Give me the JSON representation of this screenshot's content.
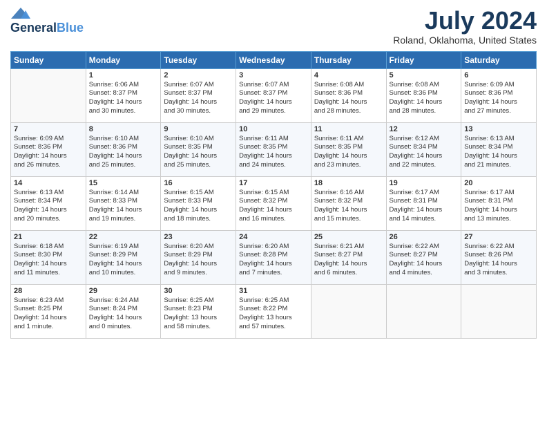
{
  "header": {
    "logo_line1": "General",
    "logo_line2": "Blue",
    "month_year": "July 2024",
    "location": "Roland, Oklahoma, United States"
  },
  "weekdays": [
    "Sunday",
    "Monday",
    "Tuesday",
    "Wednesday",
    "Thursday",
    "Friday",
    "Saturday"
  ],
  "weeks": [
    [
      {
        "day": "",
        "text": ""
      },
      {
        "day": "1",
        "text": "Sunrise: 6:06 AM\nSunset: 8:37 PM\nDaylight: 14 hours\nand 30 minutes."
      },
      {
        "day": "2",
        "text": "Sunrise: 6:07 AM\nSunset: 8:37 PM\nDaylight: 14 hours\nand 30 minutes."
      },
      {
        "day": "3",
        "text": "Sunrise: 6:07 AM\nSunset: 8:37 PM\nDaylight: 14 hours\nand 29 minutes."
      },
      {
        "day": "4",
        "text": "Sunrise: 6:08 AM\nSunset: 8:36 PM\nDaylight: 14 hours\nand 28 minutes."
      },
      {
        "day": "5",
        "text": "Sunrise: 6:08 AM\nSunset: 8:36 PM\nDaylight: 14 hours\nand 28 minutes."
      },
      {
        "day": "6",
        "text": "Sunrise: 6:09 AM\nSunset: 8:36 PM\nDaylight: 14 hours\nand 27 minutes."
      }
    ],
    [
      {
        "day": "7",
        "text": "Sunrise: 6:09 AM\nSunset: 8:36 PM\nDaylight: 14 hours\nand 26 minutes."
      },
      {
        "day": "8",
        "text": "Sunrise: 6:10 AM\nSunset: 8:36 PM\nDaylight: 14 hours\nand 25 minutes."
      },
      {
        "day": "9",
        "text": "Sunrise: 6:10 AM\nSunset: 8:35 PM\nDaylight: 14 hours\nand 25 minutes."
      },
      {
        "day": "10",
        "text": "Sunrise: 6:11 AM\nSunset: 8:35 PM\nDaylight: 14 hours\nand 24 minutes."
      },
      {
        "day": "11",
        "text": "Sunrise: 6:11 AM\nSunset: 8:35 PM\nDaylight: 14 hours\nand 23 minutes."
      },
      {
        "day": "12",
        "text": "Sunrise: 6:12 AM\nSunset: 8:34 PM\nDaylight: 14 hours\nand 22 minutes."
      },
      {
        "day": "13",
        "text": "Sunrise: 6:13 AM\nSunset: 8:34 PM\nDaylight: 14 hours\nand 21 minutes."
      }
    ],
    [
      {
        "day": "14",
        "text": "Sunrise: 6:13 AM\nSunset: 8:34 PM\nDaylight: 14 hours\nand 20 minutes."
      },
      {
        "day": "15",
        "text": "Sunrise: 6:14 AM\nSunset: 8:33 PM\nDaylight: 14 hours\nand 19 minutes."
      },
      {
        "day": "16",
        "text": "Sunrise: 6:15 AM\nSunset: 8:33 PM\nDaylight: 14 hours\nand 18 minutes."
      },
      {
        "day": "17",
        "text": "Sunrise: 6:15 AM\nSunset: 8:32 PM\nDaylight: 14 hours\nand 16 minutes."
      },
      {
        "day": "18",
        "text": "Sunrise: 6:16 AM\nSunset: 8:32 PM\nDaylight: 14 hours\nand 15 minutes."
      },
      {
        "day": "19",
        "text": "Sunrise: 6:17 AM\nSunset: 8:31 PM\nDaylight: 14 hours\nand 14 minutes."
      },
      {
        "day": "20",
        "text": "Sunrise: 6:17 AM\nSunset: 8:31 PM\nDaylight: 14 hours\nand 13 minutes."
      }
    ],
    [
      {
        "day": "21",
        "text": "Sunrise: 6:18 AM\nSunset: 8:30 PM\nDaylight: 14 hours\nand 11 minutes."
      },
      {
        "day": "22",
        "text": "Sunrise: 6:19 AM\nSunset: 8:29 PM\nDaylight: 14 hours\nand 10 minutes."
      },
      {
        "day": "23",
        "text": "Sunrise: 6:20 AM\nSunset: 8:29 PM\nDaylight: 14 hours\nand 9 minutes."
      },
      {
        "day": "24",
        "text": "Sunrise: 6:20 AM\nSunset: 8:28 PM\nDaylight: 14 hours\nand 7 minutes."
      },
      {
        "day": "25",
        "text": "Sunrise: 6:21 AM\nSunset: 8:27 PM\nDaylight: 14 hours\nand 6 minutes."
      },
      {
        "day": "26",
        "text": "Sunrise: 6:22 AM\nSunset: 8:27 PM\nDaylight: 14 hours\nand 4 minutes."
      },
      {
        "day": "27",
        "text": "Sunrise: 6:22 AM\nSunset: 8:26 PM\nDaylight: 14 hours\nand 3 minutes."
      }
    ],
    [
      {
        "day": "28",
        "text": "Sunrise: 6:23 AM\nSunset: 8:25 PM\nDaylight: 14 hours\nand 1 minute."
      },
      {
        "day": "29",
        "text": "Sunrise: 6:24 AM\nSunset: 8:24 PM\nDaylight: 14 hours\nand 0 minutes."
      },
      {
        "day": "30",
        "text": "Sunrise: 6:25 AM\nSunset: 8:23 PM\nDaylight: 13 hours\nand 58 minutes."
      },
      {
        "day": "31",
        "text": "Sunrise: 6:25 AM\nSunset: 8:22 PM\nDaylight: 13 hours\nand 57 minutes."
      },
      {
        "day": "",
        "text": ""
      },
      {
        "day": "",
        "text": ""
      },
      {
        "day": "",
        "text": ""
      }
    ]
  ]
}
